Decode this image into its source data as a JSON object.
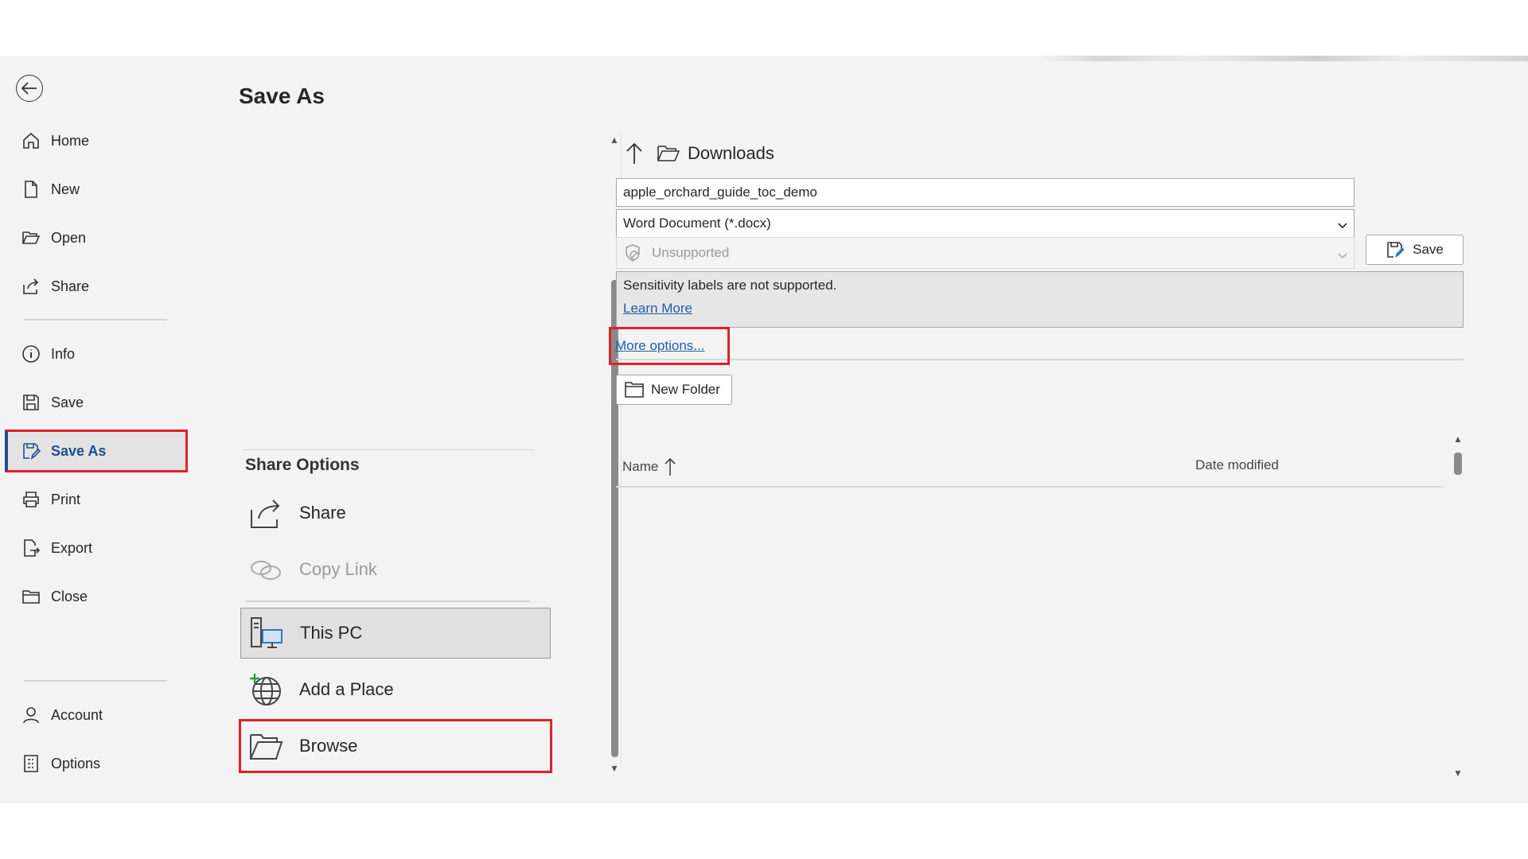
{
  "nav": {
    "items": [
      {
        "label": "Home",
        "icon": "home-icon"
      },
      {
        "label": "New",
        "icon": "new-document-icon"
      },
      {
        "label": "Open",
        "icon": "open-folder-icon"
      },
      {
        "label": "Share",
        "icon": "share-icon"
      },
      {
        "label": "Info",
        "icon": "info-icon"
      },
      {
        "label": "Save",
        "icon": "save-icon"
      },
      {
        "label": "Save As",
        "icon": "save-as-icon",
        "active": true
      },
      {
        "label": "Print",
        "icon": "print-icon"
      },
      {
        "label": "Export",
        "icon": "export-icon"
      },
      {
        "label": "Close",
        "icon": "close-folder-icon"
      },
      {
        "label": "Account",
        "icon": "account-icon"
      },
      {
        "label": "Options",
        "icon": "options-icon"
      }
    ]
  },
  "page": {
    "title": "Save As"
  },
  "locations": {
    "share_options_heading": "Share Options",
    "share_label": "Share",
    "copy_link_label": "Copy Link",
    "this_pc_label": "This PC",
    "add_place_label": "Add a Place",
    "browse_label": "Browse"
  },
  "panel": {
    "current_folder": "Downloads",
    "filename_value": "apple_orchard_guide_toc_demo",
    "filetype_value": "Word Document (*.docx)",
    "sensitivity_value": "Unsupported",
    "save_label": "Save",
    "sensitivity_message": "Sensitivity labels are not supported.",
    "learn_more": "Learn More",
    "more_options": "More options...",
    "new_folder": "New Folder",
    "col_name": "Name",
    "col_date": "Date modified"
  },
  "colors": {
    "accent": "#1f4e8c",
    "highlight": "#e0202a",
    "link": "#1f5fa8"
  }
}
